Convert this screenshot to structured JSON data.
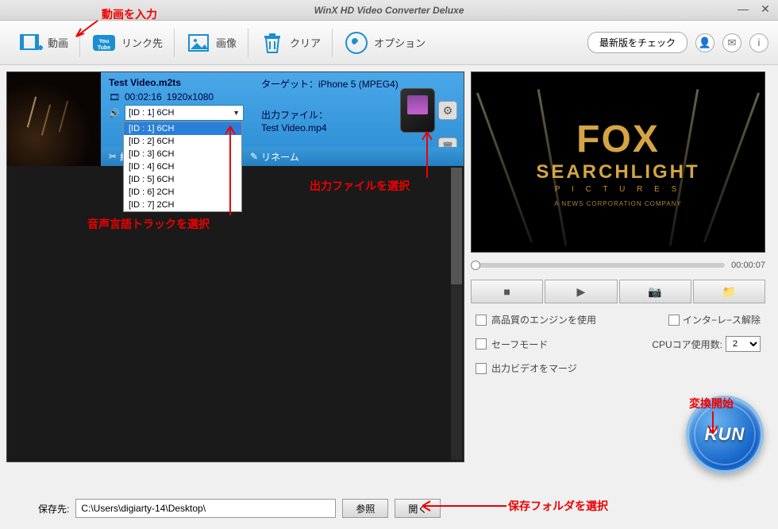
{
  "title": "WinX HD Video Converter Deluxe",
  "toolbar": {
    "video": "動画",
    "link": "リンク先",
    "image": "画像",
    "clear": "クリア",
    "option": "オプション",
    "update": "最新版をチェック"
  },
  "video": {
    "filename": "Test Video.m2ts",
    "duration": "00:02:16",
    "resolution": "1920x1080",
    "audio_selected": "[ID : 1] 6CH",
    "audio_options": [
      "[ID : 1] 6CH",
      "[ID : 2] 6CH",
      "[ID : 3] 6CH",
      "[ID : 4] 6CH",
      "[ID : 5] 6CH",
      "[ID : 6] 2CH",
      "[ID : 7] 2CH"
    ],
    "target_label": "ターゲット：",
    "target_value": "iPhone 5 (MPEG4)",
    "output_label": "出力ファイル：",
    "output_value": "Test Video.mp4",
    "edit": "編集",
    "rename": "リネーム"
  },
  "preview": {
    "fox": "FOX",
    "searchlight": "SEARCHLIGHT",
    "pictures": "P I C T U R E S",
    "corp": "A NEWS CORPORATION COMPANY",
    "time": "00:00:07"
  },
  "options": {
    "hq_engine": "高品質のエンジンを使用",
    "deinterlace": "インタ−レ−ス解除",
    "safe_mode": "セーフモード",
    "cpu_label": "CPUコア使用数:",
    "cpu_value": "2",
    "merge": "出力ビデオをマージ"
  },
  "run": "RUN",
  "bottom": {
    "save_label": "保存先:",
    "path": "C:\\Users\\digiarty-14\\Desktop\\",
    "browse": "参照",
    "open": "開く"
  },
  "annotations": {
    "input_video": "動画を入力",
    "select_audio": "音声言語トラックを選択",
    "select_output": "出力ファイルを選択",
    "start_convert": "変換開始",
    "select_folder": "保存フォルダを選択"
  }
}
